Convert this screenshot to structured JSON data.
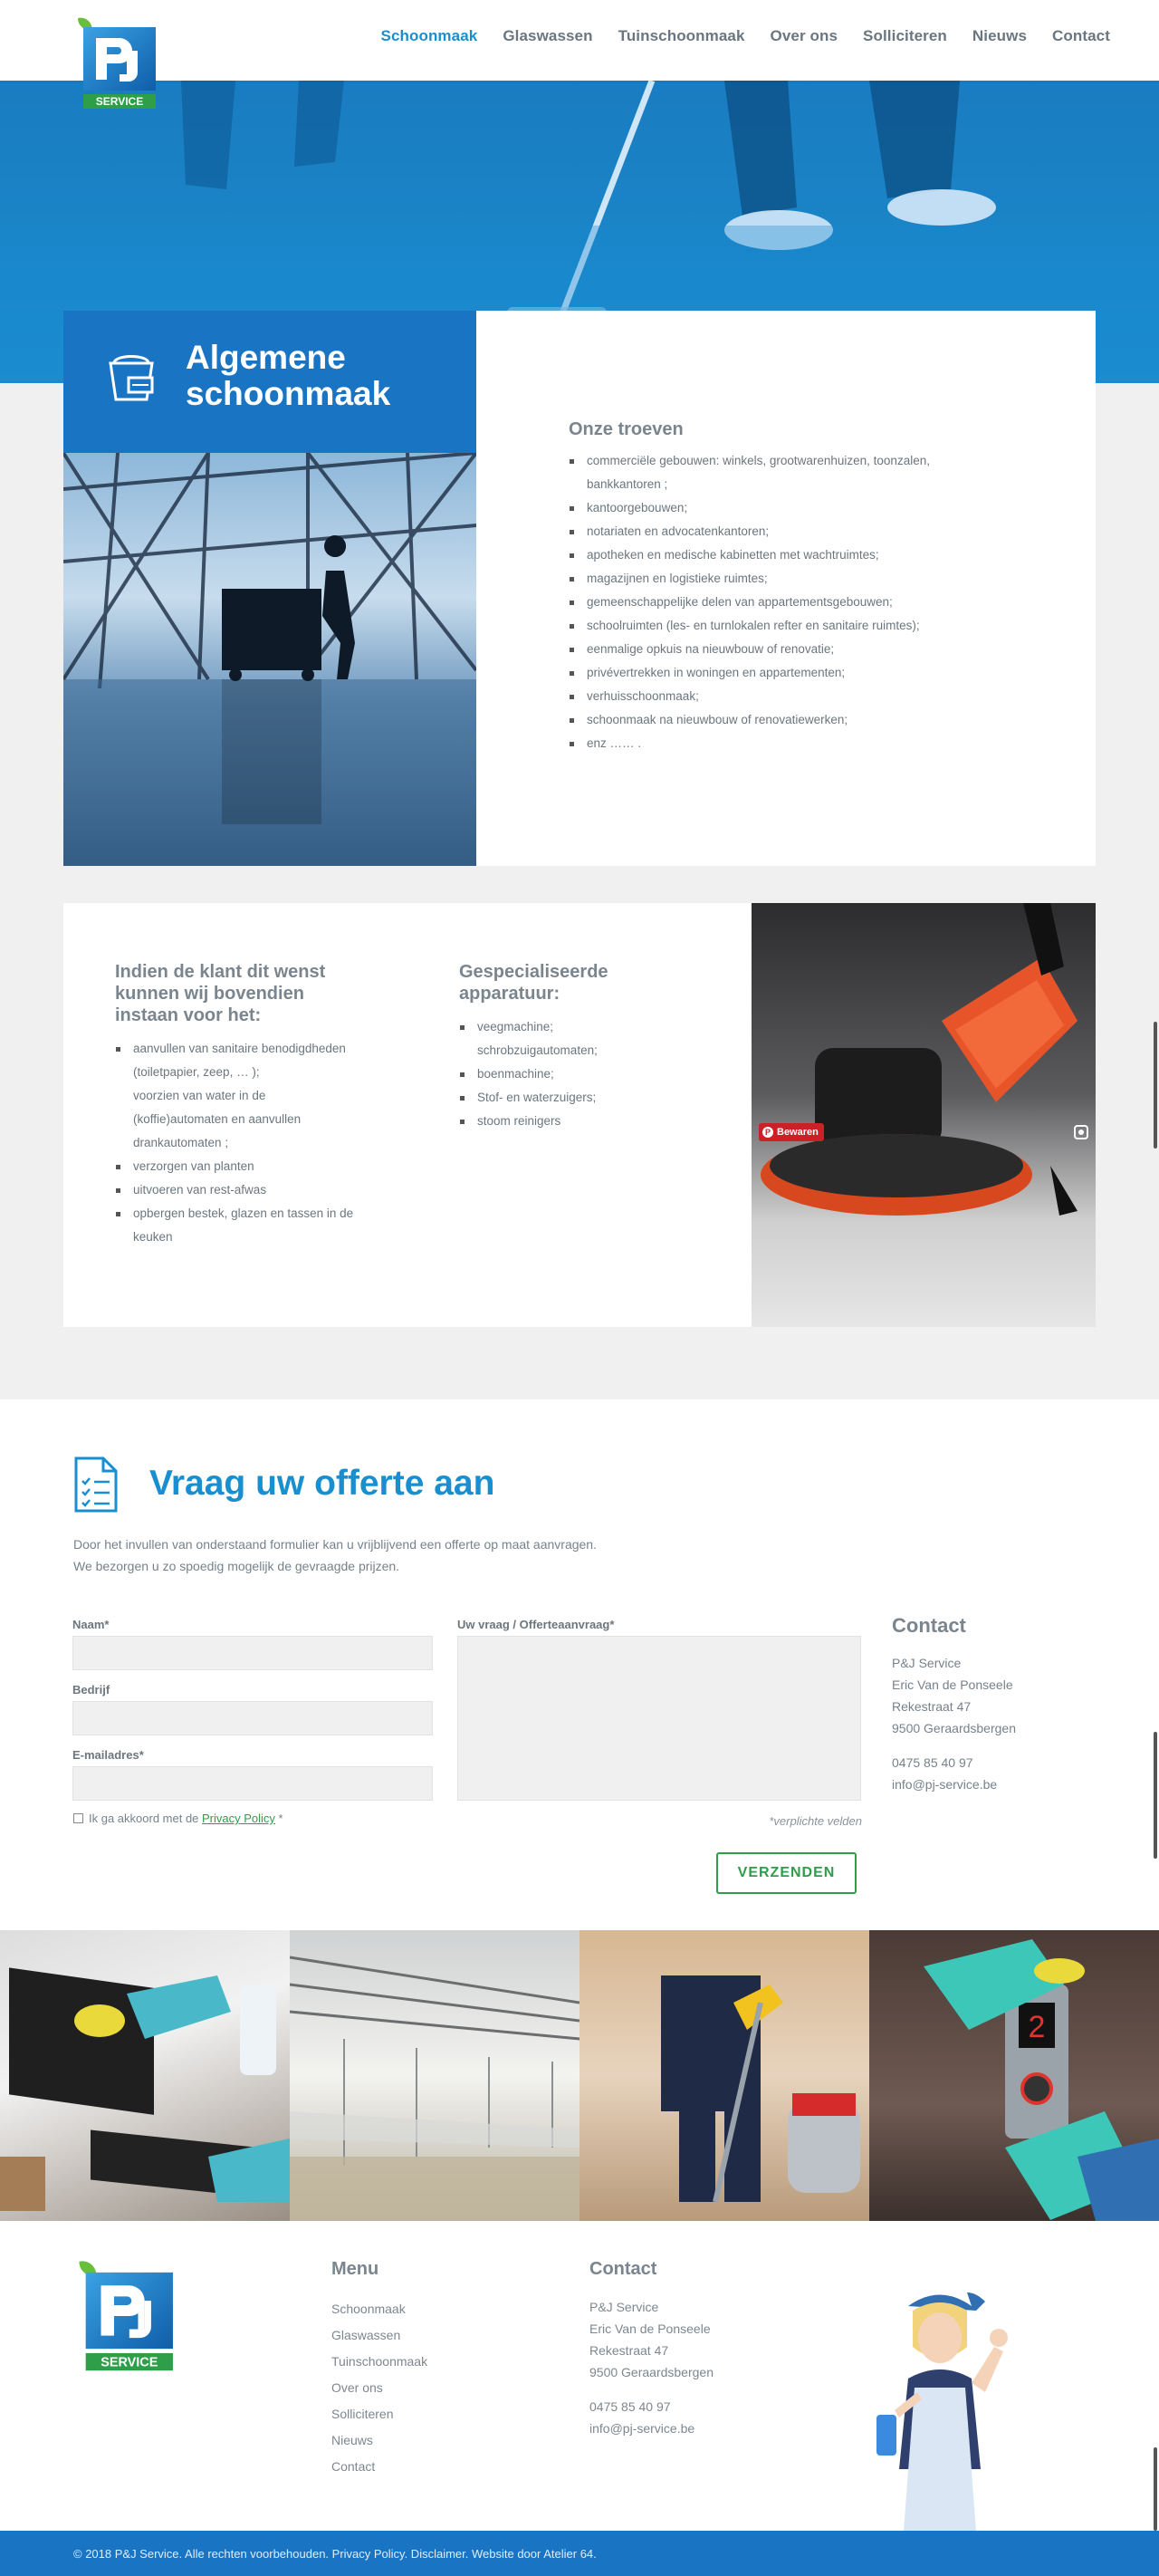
{
  "nav": {
    "items": [
      "Schoonmaak",
      "Glaswassen",
      "Tuinschoonmaak",
      "Over ons",
      "Solliciteren",
      "Nieuws",
      "Contact"
    ],
    "active": "Schoonmaak"
  },
  "logo": {
    "text": "SERVICE"
  },
  "section1": {
    "title_line1": "Algemene",
    "title_line2": "schoonmaak",
    "heading": "Onze troeven",
    "items": [
      "commerciële gebouwen: winkels, grootwarenhuizen, toonzalen,",
      "bankkantoren ;",
      "kantoorgebouwen;",
      "notariaten en advocatenkantoren;",
      "apotheken en medische kabinetten met wachtruimtes;",
      "magazijnen en logistieke ruimtes;",
      "gemeenschappelijke delen van appartementsgebouwen;",
      "schoolruimten (les- en turnlokalen refter en sanitaire ruimtes);",
      "eenmalige opkuis na nieuwbouw of renovatie;",
      "privévertrekken in woningen en appartementen;",
      "verhuisschoonmaak;",
      "schoonmaak na nieuwbouw of renovatiewerken;",
      "enz …… ."
    ]
  },
  "section2": {
    "col1_heading": "Indien de klant dit wenst kunnen wij bovendien instaan voor het:",
    "col1_items": [
      "aanvullen van sanitaire benodigdheden (toiletpapier, zeep, … );",
      "voorzien van water in de (koffie)automaten en aanvullen drankautomaten ;",
      "verzorgen van planten",
      "uitvoeren van rest-afwas",
      "opbergen bestek, glazen en tassen in de keuken"
    ],
    "col2_heading": "Gespecialiseerde apparatuur:",
    "col2_items": [
      "veegmachine;",
      "schrobzuigautomaten;",
      "boenmachine;",
      "Stof- en waterzuigers;",
      "stoom reinigers"
    ],
    "pin_label": "Bewaren"
  },
  "offer": {
    "title": "Vraag uw offerte aan",
    "intro_line1": "Door het invullen van onderstaand formulier kan u vrijblijvend een offerte op maat aanvragen.",
    "intro_line2": "We bezorgen u zo spoedig mogelijk de gevraagde prijzen.",
    "label_name": "Naam*",
    "label_company": "Bedrijf",
    "label_email": "E-mailadres*",
    "label_question": "Uw vraag / Offerteaanvraag*",
    "privacy_prefix": "Ik ga akkoord met de ",
    "privacy_link": "Privacy Policy",
    "privacy_suffix": " *",
    "required_note": "*verplichte velden",
    "submit": "VERZENDEN"
  },
  "contact": {
    "heading": "Contact",
    "company": "P&J Service",
    "person": "Eric Van de Ponseele",
    "street": "Rekestraat 47",
    "city": "9500 Geraardsbergen",
    "phone": "0475 85 40 97",
    "email": "info@pj-service.be"
  },
  "footer": {
    "menu_heading": "Menu",
    "menu_items": [
      "Schoonmaak",
      "Glaswassen",
      "Tuinschoonmaak",
      "Over ons",
      "Solliciteren",
      "Nieuws",
      "Contact"
    ],
    "contact_heading": "Contact",
    "company": "P&J Service",
    "person": "Eric Van de Ponseele",
    "street": "Rekestraat 47",
    "city": "9500 Geraardsbergen",
    "phone": "0475 85 40 97",
    "email": "info@pj-service.be",
    "copyright": "© 2018 P&J Service. Alle rechten voorbehouden. Privacy Policy. Disclaimer. Website door Atelier 64."
  },
  "colors": {
    "brand_blue": "#1a74c4",
    "accent_blue": "#1a8fcf",
    "green": "#2e9e49"
  }
}
